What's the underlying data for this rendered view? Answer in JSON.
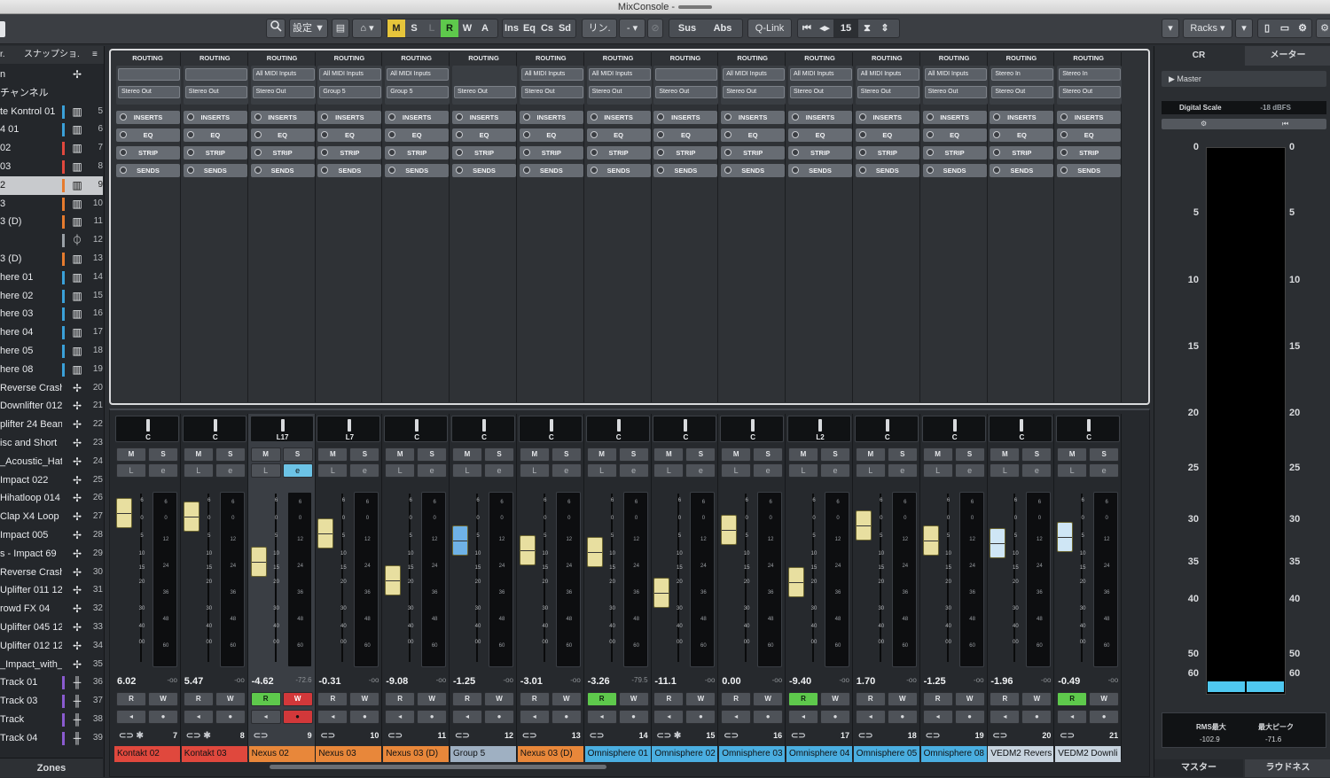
{
  "window": {
    "title": "MixConsole -"
  },
  "toolbar": {
    "search_icon": "magnifier",
    "settings_label": "設定",
    "settings_caret": "▼",
    "m": "M",
    "s": "S",
    "l": "L",
    "r": "R",
    "w": "W",
    "a": "A",
    "ins": "Ins",
    "eq": "Eq",
    "cs": "Cs",
    "sd": "Sd",
    "link": "リン.",
    "link_value": "-",
    "sus": "Sus",
    "abs": "Abs",
    "qlink": "Q-Link",
    "channel_count": "15",
    "racks": "Racks"
  },
  "left_panel": {
    "header_left": "r.",
    "header_right": "スナップショ.",
    "header_menu": "≡",
    "rows": [
      {
        "name": "n",
        "icon": "audio",
        "num": ""
      },
      {
        "name": "チャンネル",
        "icon": "",
        "num": ""
      },
      {
        "name": "te Kontrol 01",
        "icon": "instrument",
        "num": "5",
        "color": "#3aa0d8"
      },
      {
        "name": "4 01",
        "icon": "instrument",
        "num": "6",
        "color": "#3aa0d8"
      },
      {
        "name": "02",
        "icon": "instrument",
        "num": "7",
        "color": "#e0483d"
      },
      {
        "name": "03",
        "icon": "instrument",
        "num": "8",
        "color": "#e0483d"
      },
      {
        "name": "2",
        "icon": "instrument",
        "num": "9",
        "color": "#e67b2e",
        "selected": true
      },
      {
        "name": "3",
        "icon": "instrument",
        "num": "10",
        "color": "#e67b2e"
      },
      {
        "name": "3 (D)",
        "icon": "instrument",
        "num": "11",
        "color": "#e67b2e"
      },
      {
        "name": "",
        "icon": "group",
        "num": "12",
        "color": "#9aa0a6"
      },
      {
        "name": "3 (D)",
        "icon": "instrument",
        "num": "13",
        "color": "#e67b2e"
      },
      {
        "name": "here 01",
        "icon": "instrument",
        "num": "14",
        "color": "#3aa0d8"
      },
      {
        "name": "here 02",
        "icon": "instrument",
        "num": "15",
        "color": "#3aa0d8"
      },
      {
        "name": "here 03",
        "icon": "instrument",
        "num": "16",
        "color": "#3aa0d8"
      },
      {
        "name": "here 04",
        "icon": "instrument",
        "num": "17",
        "color": "#3aa0d8"
      },
      {
        "name": "here 05",
        "icon": "instrument",
        "num": "18",
        "color": "#3aa0d8"
      },
      {
        "name": "here 08",
        "icon": "instrument",
        "num": "19",
        "color": "#3aa0d8"
      },
      {
        "name": "Reverse Crash",
        "icon": "audio",
        "num": "20"
      },
      {
        "name": "Downlifter 012",
        "icon": "audio",
        "num": "21"
      },
      {
        "name": "plifter 24 Bean",
        "icon": "audio",
        "num": "22"
      },
      {
        "name": "isc and Short",
        "icon": "audio",
        "num": "23"
      },
      {
        "name": "_Acoustic_Hat",
        "icon": "audio",
        "num": "24"
      },
      {
        "name": "Impact 022",
        "icon": "audio",
        "num": "25"
      },
      {
        "name": "Hihatloop 014",
        "icon": "audio",
        "num": "26"
      },
      {
        "name": "Clap X4 Loop",
        "icon": "audio",
        "num": "27"
      },
      {
        "name": "Impact 005",
        "icon": "audio",
        "num": "28"
      },
      {
        "name": "s - Impact 69",
        "icon": "audio",
        "num": "29"
      },
      {
        "name": "Reverse Crash",
        "icon": "audio",
        "num": "30"
      },
      {
        "name": "Uplifter 011 12",
        "icon": "audio",
        "num": "31"
      },
      {
        "name": "rowd FX 04",
        "icon": "audio",
        "num": "32"
      },
      {
        "name": "Uplifter 045 12",
        "icon": "audio",
        "num": "33"
      },
      {
        "name": "Uplifter 012 12",
        "icon": "audio",
        "num": "34"
      },
      {
        "name": "_Impact_with_",
        "icon": "audio",
        "num": "35"
      },
      {
        "name": "Track 01",
        "icon": "midi",
        "num": "36",
        "color": "#8a5bd0"
      },
      {
        "name": "Track 03",
        "icon": "midi",
        "num": "37",
        "color": "#8a5bd0"
      },
      {
        "name": "Track",
        "icon": "midi",
        "num": "38",
        "color": "#8a5bd0"
      },
      {
        "name": "Track 04",
        "icon": "midi",
        "num": "39",
        "color": "#8a5bd0"
      }
    ],
    "zones_label": "Zones"
  },
  "rack": {
    "routing_label": "ROUTING",
    "inserts_label": "INSERTS",
    "eq_label": "EQ",
    "strip_label": "STRIP",
    "sends_label": "SENDS",
    "columns": [
      {
        "input": "",
        "output": "Stereo Out"
      },
      {
        "input": "",
        "output": "Stereo Out"
      },
      {
        "input": "All MIDI Inputs",
        "output": "Stereo Out"
      },
      {
        "input": "All MIDI Inputs",
        "output": "Group 5"
      },
      {
        "input": "All MIDI Inputs",
        "output": "Group 5"
      },
      {
        "input": "",
        "output": "Stereo Out",
        "noinput": true
      },
      {
        "input": "All MIDI Inputs",
        "output": "Stereo Out"
      },
      {
        "input": "All MIDI Inputs",
        "output": "Stereo Out"
      },
      {
        "input": "",
        "output": "Stereo Out"
      },
      {
        "input": "All MIDI Inputs",
        "output": "Stereo Out"
      },
      {
        "input": "All MIDI Inputs",
        "output": "Stereo Out"
      },
      {
        "input": "All MIDI Inputs",
        "output": "Stereo Out"
      },
      {
        "input": "All MIDI Inputs",
        "output": "Stereo Out"
      },
      {
        "input": "Stereo In",
        "output": "Stereo Out"
      },
      {
        "input": "Stereo In",
        "output": "Stereo Out"
      }
    ]
  },
  "channels": [
    {
      "pan": "C",
      "vol": "6.02",
      "peak": "-oo",
      "num": "7",
      "name": "Kontakt 02",
      "color": "#e0483d",
      "fader": 0.92,
      "cap": "#e8dfa0",
      "r": false,
      "w": false,
      "snow": true
    },
    {
      "pan": "C",
      "vol": "5.47",
      "peak": "-oo",
      "num": "8",
      "name": "Kontakt 03",
      "color": "#e0483d",
      "fader": 0.9,
      "cap": "#e8dfa0",
      "snow": true
    },
    {
      "pan": "L17",
      "vol": "-4.62",
      "peak": "-72.6",
      "num": "9",
      "name": "Nexus 02",
      "color": "#e8873a",
      "fader": 0.63,
      "cap": "#e8dfa0",
      "selected": true,
      "rOn": true,
      "wRec": true,
      "eOn": true
    },
    {
      "pan": "L7",
      "vol": "-0.31",
      "peak": "-oo",
      "num": "10",
      "name": "Nexus 03",
      "color": "#e8873a",
      "fader": 0.8,
      "cap": "#e8dfa0"
    },
    {
      "pan": "C",
      "vol": "-9.08",
      "peak": "-oo",
      "num": "11",
      "name": "Nexus 03 (D)",
      "color": "#e8873a",
      "fader": 0.52,
      "cap": "#e8dfa0"
    },
    {
      "pan": "C",
      "vol": "-1.25",
      "peak": "-oo",
      "num": "12",
      "name": "Group 5",
      "color": "#9fb0c2",
      "fader": 0.76,
      "cap": "#6fb2e6",
      "group": true
    },
    {
      "pan": "C",
      "vol": "-3.01",
      "peak": "-oo",
      "num": "13",
      "name": "Nexus 03 (D)",
      "color": "#e8873a",
      "fader": 0.7,
      "cap": "#e8dfa0"
    },
    {
      "pan": "C",
      "vol": "-3.26",
      "peak": "-79.5",
      "num": "14",
      "name": "Omnisphere 01",
      "color": "#4aaee0",
      "fader": 0.69,
      "cap": "#e8dfa0",
      "rOn": true
    },
    {
      "pan": "C",
      "vol": "-11.1",
      "peak": "-oo",
      "num": "15",
      "name": "Omnisphere 02",
      "color": "#4aaee0",
      "fader": 0.45,
      "cap": "#e8dfa0",
      "snow": true
    },
    {
      "pan": "C",
      "vol": "0.00",
      "peak": "-oo",
      "num": "16",
      "name": "Omnisphere 03",
      "color": "#4aaee0",
      "fader": 0.82,
      "cap": "#e8dfa0"
    },
    {
      "pan": "L2",
      "vol": "-9.40",
      "peak": "-oo",
      "num": "17",
      "name": "Omnisphere 04",
      "color": "#4aaee0",
      "fader": 0.51,
      "cap": "#e8dfa0",
      "rOn": true
    },
    {
      "pan": "C",
      "vol": "1.70",
      "peak": "-oo",
      "num": "18",
      "name": "Omnisphere 05",
      "color": "#4aaee0",
      "fader": 0.85,
      "cap": "#e8dfa0"
    },
    {
      "pan": "C",
      "vol": "-1.25",
      "peak": "-oo",
      "num": "19",
      "name": "Omnisphere 08",
      "color": "#4aaee0",
      "fader": 0.76,
      "cap": "#e8dfa0"
    },
    {
      "pan": "C",
      "vol": "-1.96",
      "peak": "-oo",
      "num": "20",
      "name": "VEDM2 Revers",
      "color": "#c7d3de",
      "fader": 0.74,
      "cap": "#cfe6f5"
    },
    {
      "pan": "C",
      "vol": "-0.49",
      "peak": "-oo",
      "num": "21",
      "name": "VEDM2 Downli",
      "color": "#c7d3de",
      "fader": 0.78,
      "cap": "#cfe6f5",
      "rOn": true
    }
  ],
  "fader_scale": [
    "6",
    "0",
    "5",
    "10",
    "15",
    "20",
    "30",
    "40",
    "00"
  ],
  "meter_scale": [
    "6",
    "0",
    "12",
    "24",
    "36",
    "48",
    "60"
  ],
  "strip_buttons": {
    "m": "M",
    "s": "S",
    "r": "R",
    "w": "W"
  },
  "right_panel": {
    "tab_cr": "CR",
    "tab_meter": "メーター",
    "master": "Master",
    "scale_label": "Digital Scale",
    "scale_value": "-18 dBFS",
    "scale": [
      "0",
      "5",
      "10",
      "15",
      "20",
      "25",
      "30",
      "35",
      "40",
      "50",
      "60"
    ],
    "rms_label": "RMS最大",
    "rms_value": "-102.9",
    "peak_label": "最大ピーク",
    "peak_value": "-71.6",
    "tab_master": "マスター",
    "tab_loudness": "ラウドネス"
  }
}
